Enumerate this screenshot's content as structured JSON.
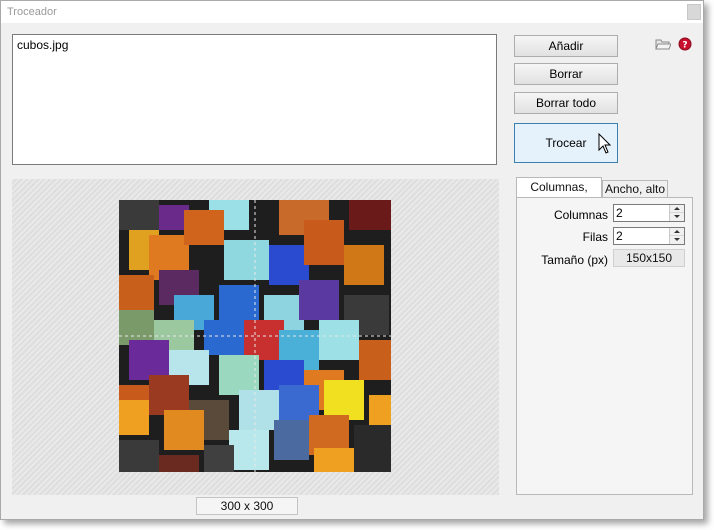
{
  "window": {
    "title": "Troceador"
  },
  "files": {
    "items": [
      "cubos.jpg"
    ]
  },
  "buttons": {
    "add": "Añadir",
    "delete": "Borrar",
    "delete_all": "Borrar todo",
    "split": "Trocear"
  },
  "icons": {
    "folder": "folder-icon",
    "help": "help-icon",
    "cursor": "mouse-cursor-icon"
  },
  "preview": {
    "size_label": "300 x 300",
    "grid_columns": 2,
    "grid_rows": 2
  },
  "tabs": {
    "columns_rows": "Columnas, Filas",
    "width_height": "Ancho, alto"
  },
  "settings": {
    "columns_label": "Columnas",
    "columns_value": "2",
    "rows_label": "Filas",
    "rows_value": "2",
    "size_label": "Tamaño (px)",
    "size_value": "150x150"
  },
  "colors": {
    "accent_border": "#3c7fb1",
    "accent_fill": "#e5f1fb",
    "help_red": "#c8102e"
  }
}
